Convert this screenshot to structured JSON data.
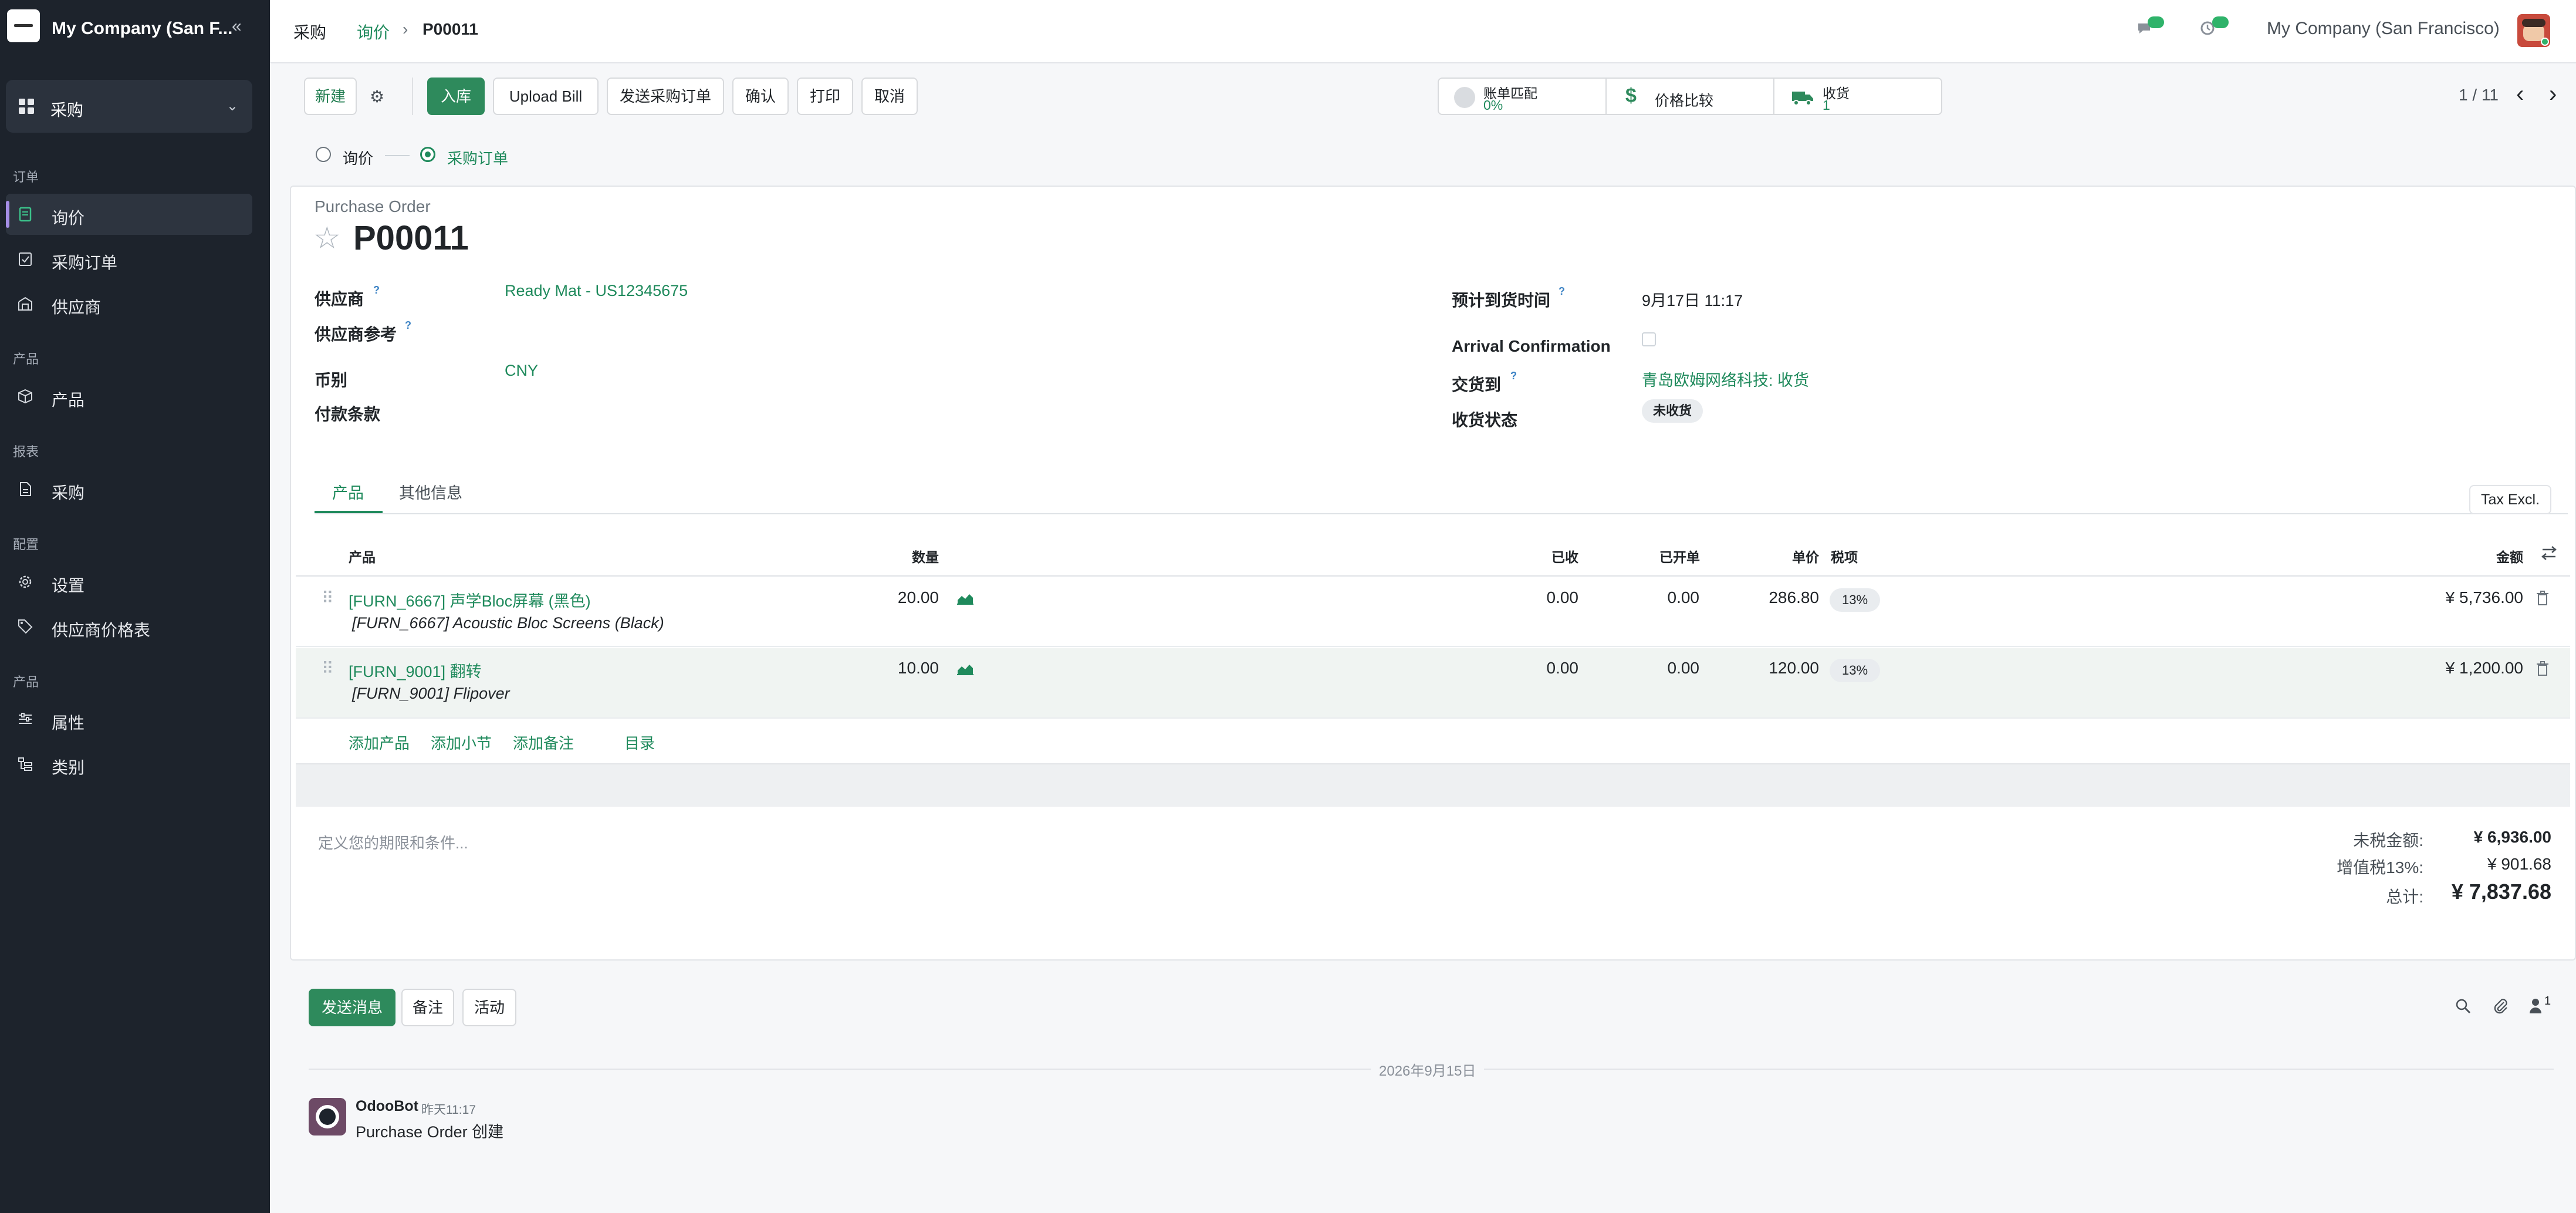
{
  "sidebar": {
    "company": "My Company (San F...",
    "app": "采购",
    "sections": [
      {
        "title": "订单",
        "items": [
          "询价",
          "采购订单",
          "供应商"
        ]
      },
      {
        "title": "产品",
        "items": [
          "产品"
        ]
      },
      {
        "title": "报表",
        "items": [
          "采购"
        ]
      },
      {
        "title": "配置",
        "items": [
          "设置",
          "供应商价格表"
        ]
      },
      {
        "title": "产品",
        "items": [
          "属性",
          "类别"
        ]
      }
    ]
  },
  "topbar": {
    "app_name": "采购",
    "breadcrumb_parent": "询价",
    "breadcrumb_sep": "›",
    "breadcrumb_current": "P00011",
    "company": "My Company (San Francisco)"
  },
  "control": {
    "new": "新建",
    "buttons": [
      "入库",
      "Upload Bill",
      "发送采购订单",
      "确认",
      "打印",
      "取消"
    ],
    "smart": {
      "bill_label": "账单匹配",
      "bill_value": "0%",
      "compare": "价格比较",
      "receipt_label": "收货",
      "receipt_value": "1"
    },
    "pager": "1 / 11"
  },
  "statusbar": {
    "steps": [
      "询价",
      "采购订单"
    ]
  },
  "form": {
    "subtitle": "Purchase Order",
    "title": "P00011",
    "left": [
      {
        "label": "供应商",
        "help": "?",
        "value": "Ready Mat - US12345675"
      },
      {
        "label": "供应商参考",
        "help": "?",
        "value": ""
      },
      {
        "label": "币别",
        "help": "",
        "value": "CNY"
      },
      {
        "label": "付款条款",
        "help": "",
        "value": ""
      }
    ],
    "right": [
      {
        "label": "预计到货时间",
        "help": "?",
        "value": "9月17日 11:17"
      },
      {
        "label": "Arrival Confirmation",
        "help": "",
        "value": ""
      },
      {
        "label": "交货到",
        "help": "?",
        "value": "青岛欧姆网络科技: 收货"
      },
      {
        "label": "收货状态",
        "help": "",
        "value": "未收货"
      }
    ],
    "tabs": [
      "产品",
      "其他信息"
    ],
    "tax_toggle": "Tax Excl."
  },
  "table": {
    "headers": [
      "产品",
      "数量",
      "已收",
      "已开单",
      "单价",
      "税项",
      "金额"
    ],
    "rows": [
      {
        "product": "[FURN_6667] 声学Bloc屏幕 (黑色)",
        "description": "[FURN_6667] Acoustic Bloc Screens (Black)",
        "qty": "20.00",
        "received": "0.00",
        "billed": "0.00",
        "price": "286.80",
        "tax": "13%",
        "amount": "¥ 5,736.00"
      },
      {
        "product": "[FURN_9001] 翻转",
        "description": "[FURN_9001] Flipover",
        "qty": "10.00",
        "received": "0.00",
        "billed": "0.00",
        "price": "120.00",
        "tax": "13%",
        "amount": "¥ 1,200.00"
      }
    ],
    "add_links": [
      "添加产品",
      "添加小节",
      "添加备注",
      "目录"
    ]
  },
  "terms_placeholder": "定义您的期限和条件...",
  "totals": [
    {
      "label": "未税金额:",
      "value": "¥ 6,936.00"
    },
    {
      "label": "增值税13%:",
      "value": "¥ 901.68"
    },
    {
      "label": "总计:",
      "value": "¥ 7,837.68"
    }
  ],
  "chatter": {
    "buttons": [
      "发送消息",
      "备注",
      "活动"
    ],
    "follower_count": "1",
    "date": "2026年9月15日",
    "author": "OdooBot",
    "time": "昨天11:17",
    "message": "Purchase Order 创建"
  },
  "colors": {
    "primary": "#2e8a5c",
    "link": "#1f8a5c",
    "sidebar": "#1d232c",
    "accent": "#a58ee6"
  }
}
